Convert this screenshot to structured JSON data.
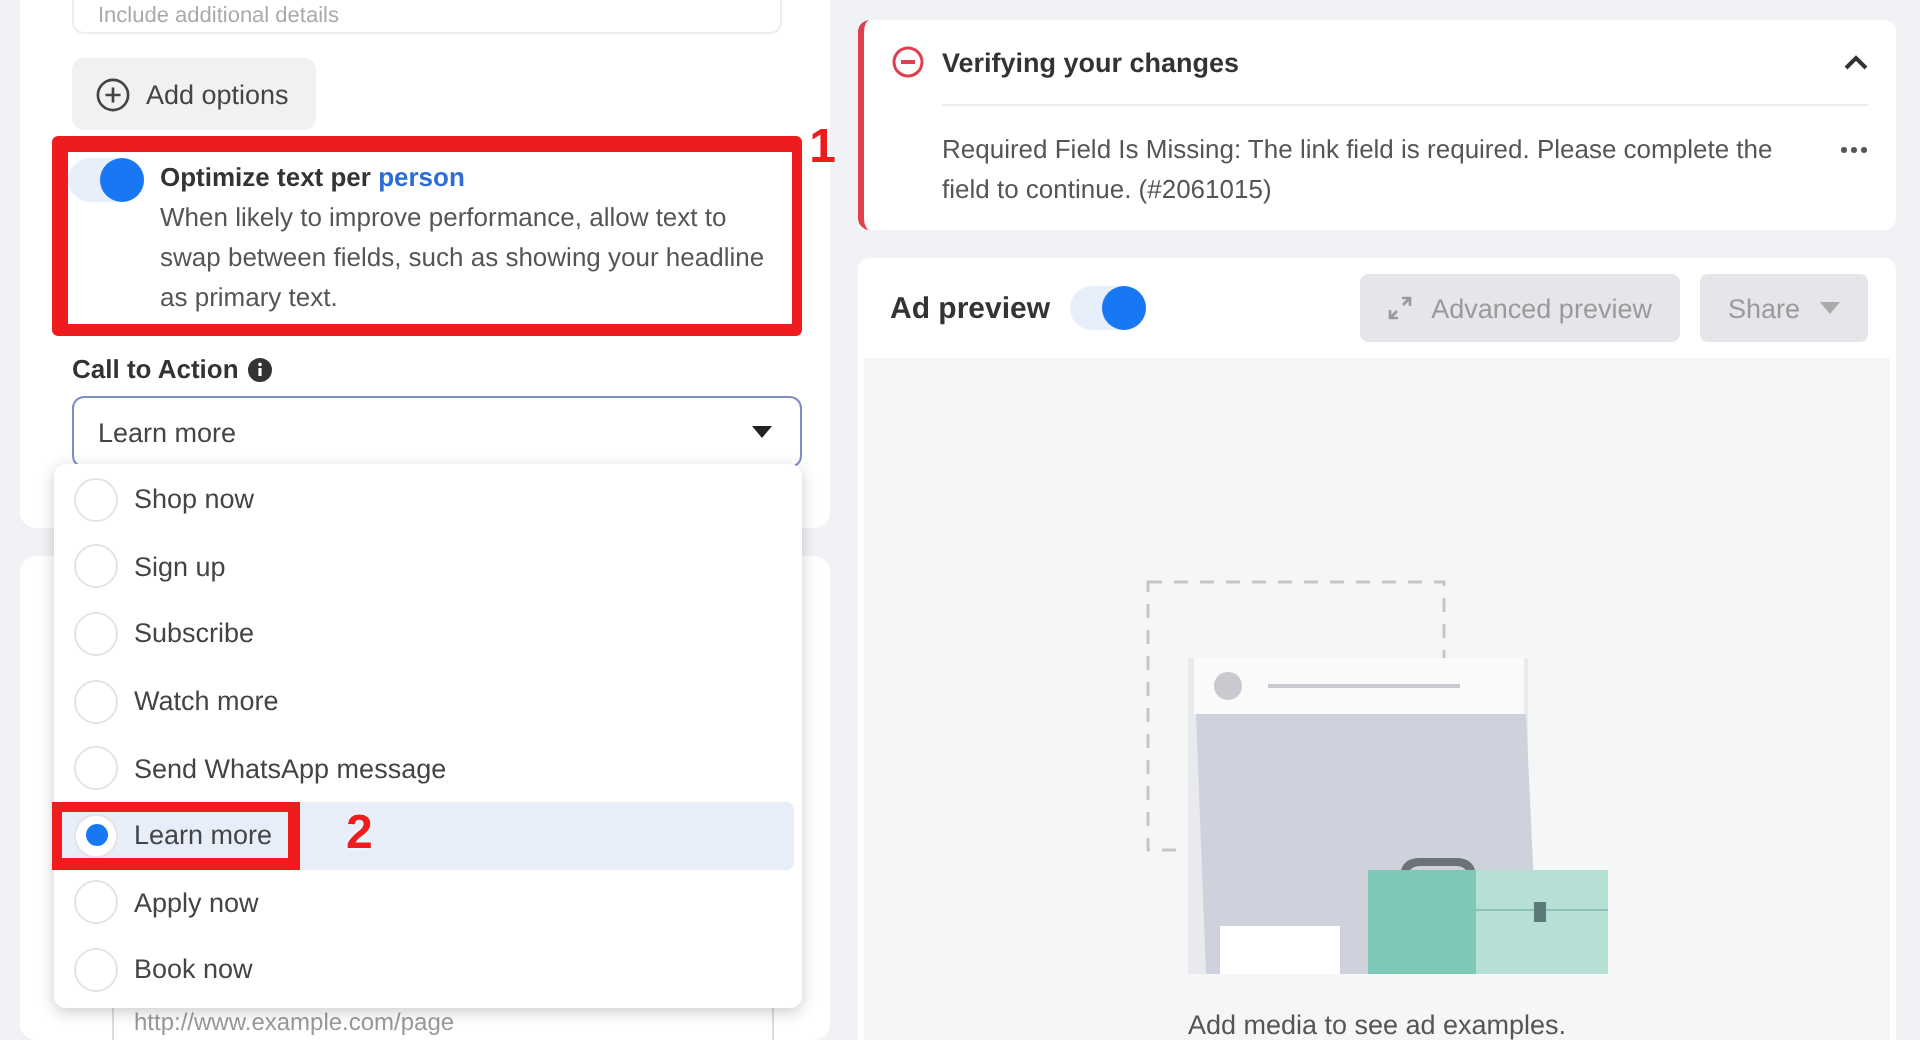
{
  "top_field": {
    "placeholder": "Include additional details"
  },
  "add_options_button": {
    "label": "Add options"
  },
  "optimize_text": {
    "on": true,
    "title": "Optimize text per ",
    "title_link": "person",
    "description": "When likely to improve performance, allow text to swap between fields, such as showing your headline as primary text."
  },
  "call_to_action": {
    "label": "Call to Action",
    "value": "Learn more",
    "options": [
      {
        "label": "Shop now",
        "selected": false
      },
      {
        "label": "Sign up",
        "selected": false
      },
      {
        "label": "Subscribe",
        "selected": false
      },
      {
        "label": "Watch more",
        "selected": false
      },
      {
        "label": "Send WhatsApp message",
        "selected": false
      },
      {
        "label": "Learn more",
        "selected": true
      },
      {
        "label": "Apply now",
        "selected": false
      },
      {
        "label": "Book now",
        "selected": false
      }
    ]
  },
  "website_url": {
    "placeholder": "http://www.example.com/page"
  },
  "alert": {
    "title": "Verifying your changes",
    "expanded": true,
    "message": "Required Field Is Missing: The link field is required. Please complete the field to continue. (#2061015)"
  },
  "ad_preview": {
    "title": "Ad preview",
    "on": true,
    "advanced_preview_button": "Advanced preview",
    "share_button": "Share",
    "empty_message": "Add media to see ad examples."
  },
  "annotations": [
    {
      "label": "1"
    },
    {
      "label": "2"
    }
  ]
}
